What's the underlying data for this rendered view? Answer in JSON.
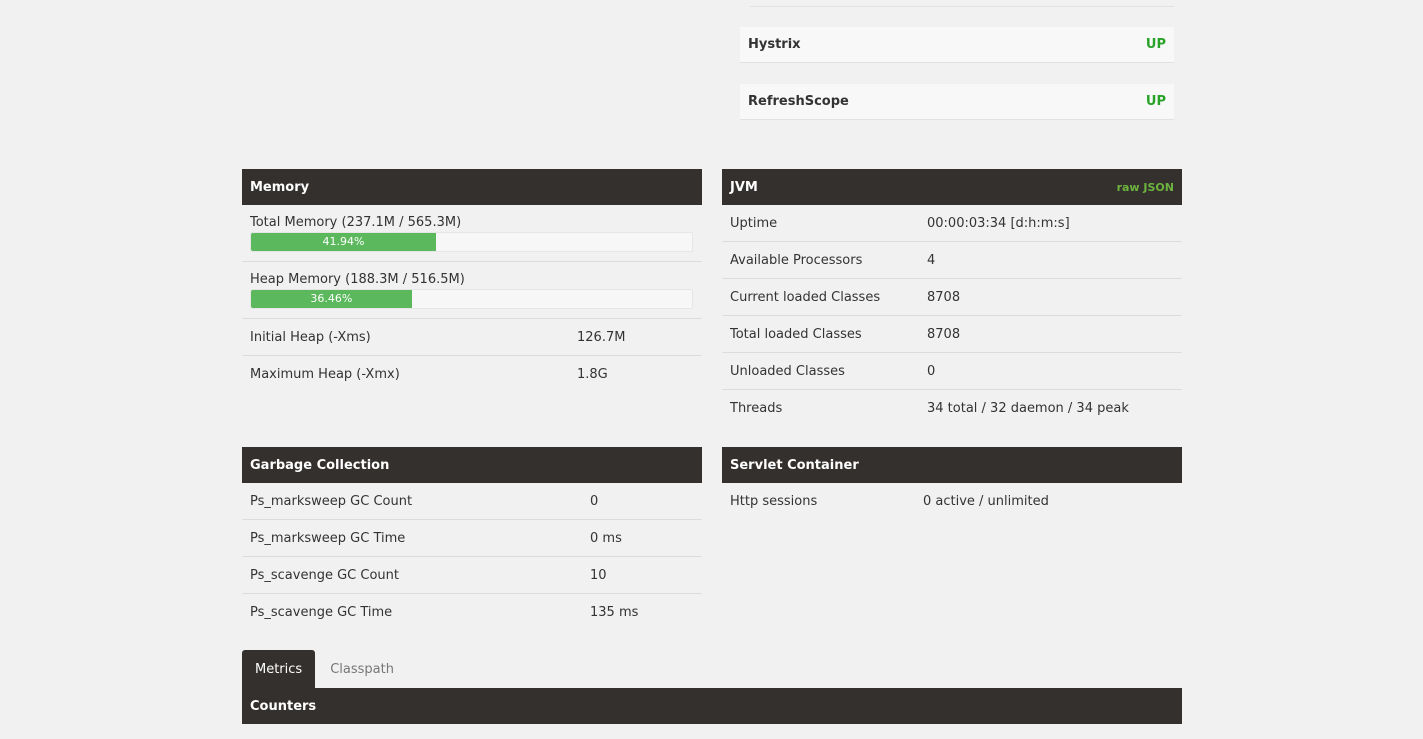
{
  "health": {
    "items": [
      {
        "name": "Hystrix",
        "status": "UP"
      },
      {
        "name": "RefreshScope",
        "status": "UP"
      }
    ]
  },
  "memory": {
    "title": "Memory",
    "total_label": "Total Memory (237.1M / 565.3M)",
    "total_percent": 41.94,
    "total_percent_text": "41.94%",
    "heap_label": "Heap Memory (188.3M / 516.5M)",
    "heap_percent": 36.46,
    "heap_percent_text": "36.46%",
    "rows": [
      {
        "key": "Initial Heap (-Xms)",
        "value": "126.7M"
      },
      {
        "key": "Maximum Heap (-Xmx)",
        "value": "1.8G"
      }
    ]
  },
  "jvm": {
    "title": "JVM",
    "raw_json_label": "raw JSON",
    "rows": [
      {
        "key": "Uptime",
        "value": "00:00:03:34 [d:h:m:s]"
      },
      {
        "key": "Available Processors",
        "value": "4"
      },
      {
        "key": "Current loaded Classes",
        "value": "8708"
      },
      {
        "key": "Total loaded Classes",
        "value": "8708"
      },
      {
        "key": "Unloaded Classes",
        "value": "0"
      },
      {
        "key": "Threads",
        "value": "34 total / 32 daemon / 34 peak"
      }
    ]
  },
  "gc": {
    "title": "Garbage Collection",
    "rows": [
      {
        "key": "Ps_marksweep GC Count",
        "value": "0"
      },
      {
        "key": "Ps_marksweep GC Time",
        "value": "0 ms"
      },
      {
        "key": "Ps_scavenge GC Count",
        "value": "10"
      },
      {
        "key": "Ps_scavenge GC Time",
        "value": "135 ms"
      }
    ]
  },
  "servlet": {
    "title": "Servlet Container",
    "rows": [
      {
        "key": "Http sessions",
        "value": "0 active / unlimited"
      }
    ]
  },
  "tabs": [
    {
      "label": "Metrics",
      "active": true
    },
    {
      "label": "Classpath",
      "active": false
    }
  ],
  "counters": {
    "title": "Counters"
  },
  "colors": {
    "header_bg": "#34302d",
    "status_up": "#28a328",
    "progress": "#5cb85c",
    "raw_json": "#6db33f"
  }
}
